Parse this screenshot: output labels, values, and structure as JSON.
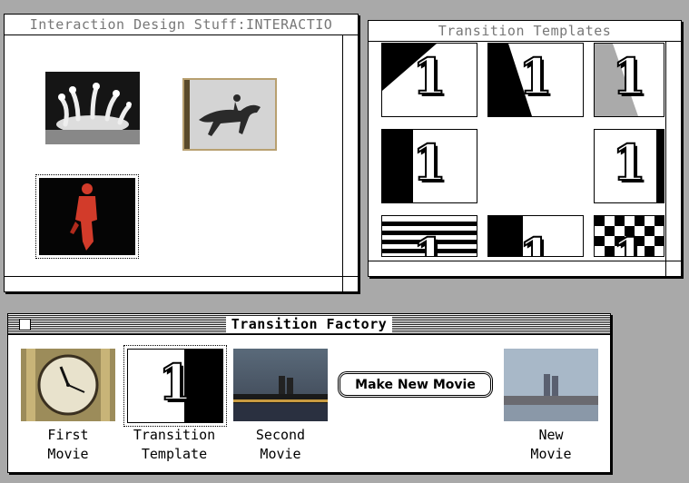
{
  "windows": {
    "interaction": {
      "title": "Interaction Design Stuff:INTERACTIO"
    },
    "templates": {
      "title": "Transition Templates",
      "digit": "1"
    },
    "factory": {
      "title": "Transition Factory",
      "make_button": "Make New Movie",
      "captions": {
        "first": [
          "First",
          "Movie"
        ],
        "template": [
          "Transition",
          "Template"
        ],
        "second": [
          "Second",
          "Movie"
        ],
        "new": [
          "New",
          "Movie"
        ]
      }
    }
  },
  "icons": [
    "milk-splash-thumbnail",
    "horse-rider-thumbnail",
    "red-figure-thumbnail",
    "clock-thumbnail",
    "city-skyline-thumbnail"
  ]
}
